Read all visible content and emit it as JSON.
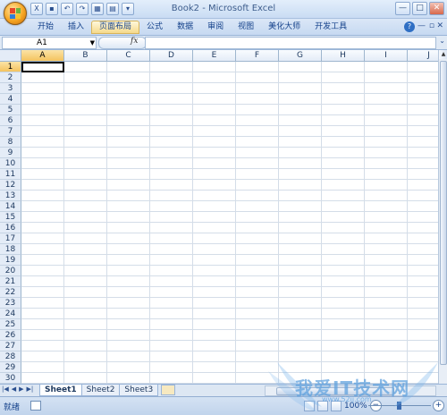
{
  "window": {
    "title": "Book2 - Microsoft Excel",
    "buttons": {
      "minimize": "—",
      "maximize": "□",
      "close": "✕"
    }
  },
  "qat": {
    "icons": [
      "excel-icon",
      "save-icon",
      "undo-icon",
      "redo-icon",
      "table-icon",
      "print-icon",
      "customize-icon"
    ]
  },
  "ribbon": {
    "tabs": [
      "开始",
      "插入",
      "页面布局",
      "公式",
      "数据",
      "审阅",
      "视图",
      "美化大师",
      "开发工具"
    ],
    "active_tab": "页面布局",
    "help": "?",
    "minimize_glyph": "—",
    "restore_glyph": "▫",
    "close_glyph": "✕"
  },
  "formula_bar": {
    "name_box": "A1",
    "fx": "fx",
    "formula": ""
  },
  "grid": {
    "columns": [
      "A",
      "B",
      "C",
      "D",
      "E",
      "F",
      "G",
      "H",
      "I",
      "J"
    ],
    "rows": [
      "1",
      "2",
      "3",
      "4",
      "5",
      "6",
      "7",
      "8",
      "9",
      "10",
      "11",
      "12",
      "13",
      "14",
      "15",
      "16",
      "17",
      "18",
      "19",
      "20",
      "21",
      "22",
      "23",
      "24",
      "25",
      "26",
      "27",
      "28",
      "29",
      "30"
    ],
    "active_cell": "A1"
  },
  "sheets": {
    "tabs": [
      "Sheet1",
      "Sheet2",
      "Sheet3"
    ],
    "active": "Sheet1"
  },
  "statusbar": {
    "status": "就绪",
    "zoom": "100%"
  },
  "watermark": {
    "text": "我爱IT技术网",
    "sub": "www.52ij.com"
  },
  "colors": {
    "selected_header": "#f4c35e",
    "gridline": "#d4dde8",
    "ribbon_bg": "#c6d9f1"
  }
}
